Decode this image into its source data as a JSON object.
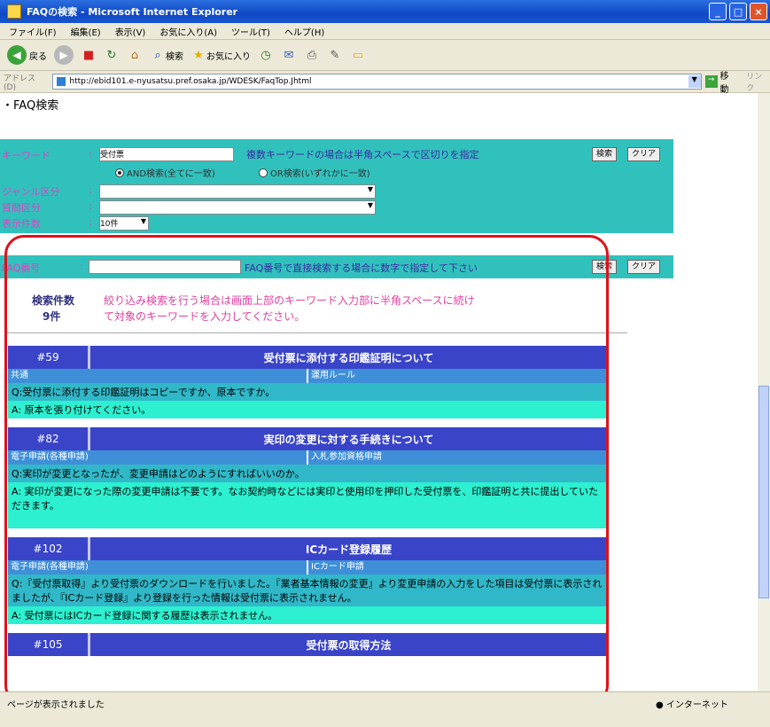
{
  "window": {
    "title": "FAQの検索 - Microsoft Internet Explorer"
  },
  "menu": [
    "ファイル(F)",
    "編集(E)",
    "表示(V)",
    "お気に入り(A)",
    "ツール(T)",
    "ヘルプ(H)"
  ],
  "toolbar": {
    "back": "戻る",
    "search": "検索",
    "favorites": "お気に入り"
  },
  "address": {
    "label": "アドレス(D)",
    "url": "http://ebid101.e-nyusatsu.pref.osaka.jp/WDESK/FaqTop.Jhtml",
    "go": "移動",
    "links": "リンク"
  },
  "page": {
    "heading": "FAQ検索",
    "keyword_label": "キーワード",
    "keyword_sep": ":",
    "keyword_value": "受付票",
    "keyword_hint": "複数キーワードの場合は半角スペースで区切りを指定",
    "search_button": "検索",
    "clear_button": "クリア",
    "radio_and": "AND検索(全てに一致)",
    "radio_or": "OR検索(いずれかに一致)",
    "genre_label": "ジャンル区分",
    "genre_sep": ":",
    "question_label": "質問区分",
    "question_sep": ":",
    "display_label": "表示件数",
    "display_sep": ":",
    "display_value": "10件",
    "faqno_label": "FAQ番号",
    "faqno_sep": ":",
    "faqno_hint": "FAQ番号で直接検索する場合に数字で指定して下さい",
    "count_label": "検索件数",
    "count_value": "9件",
    "note": "絞り込み検索を行う場合は画面上部のキーワード入力部に半角スペースに続けて対象のキーワードを入力してください。"
  },
  "faqs": [
    {
      "number": "#59",
      "title": "受付票に添付する印鑑証明について",
      "cat1": "共通",
      "cat2": "運用ルール",
      "q": "Q:受付票に添付する印鑑証明はコピーですか、原本ですか。",
      "a": "A: 原本を張り付けてください。"
    },
    {
      "number": "#82",
      "title": "実印の変更に対する手続きについて",
      "cat1": "電子申請(各種申請)",
      "cat2": "入札参加資格申請",
      "q": "Q:実印が変更となったが、変更申請はどのようにすればいいのか。",
      "a": "A: 実印が変更になった際の変更申請は不要です。なお契約時などには実印と使用印を押印した受付票を、印鑑証明と共に提出していただきます。"
    },
    {
      "number": "#102",
      "title": "ICカード登録履歴",
      "cat1": "電子申請(各種申請)",
      "cat2": "ICカード申請",
      "q": "Q:『受付票取得』より受付票のダウンロードを行いました。『業者基本情報の変更』より変更申請の入力をした項目は受付票に表示されましたが、『ICカード登録』より登録を行った情報は受付票に表示されません。",
      "a": "A: 受付票にはICカード登録に関する履歴は表示されません。"
    },
    {
      "number": "#105",
      "title": "受付票の取得方法"
    }
  ],
  "status": {
    "left": "ページが表示されました",
    "right": "インターネット"
  }
}
